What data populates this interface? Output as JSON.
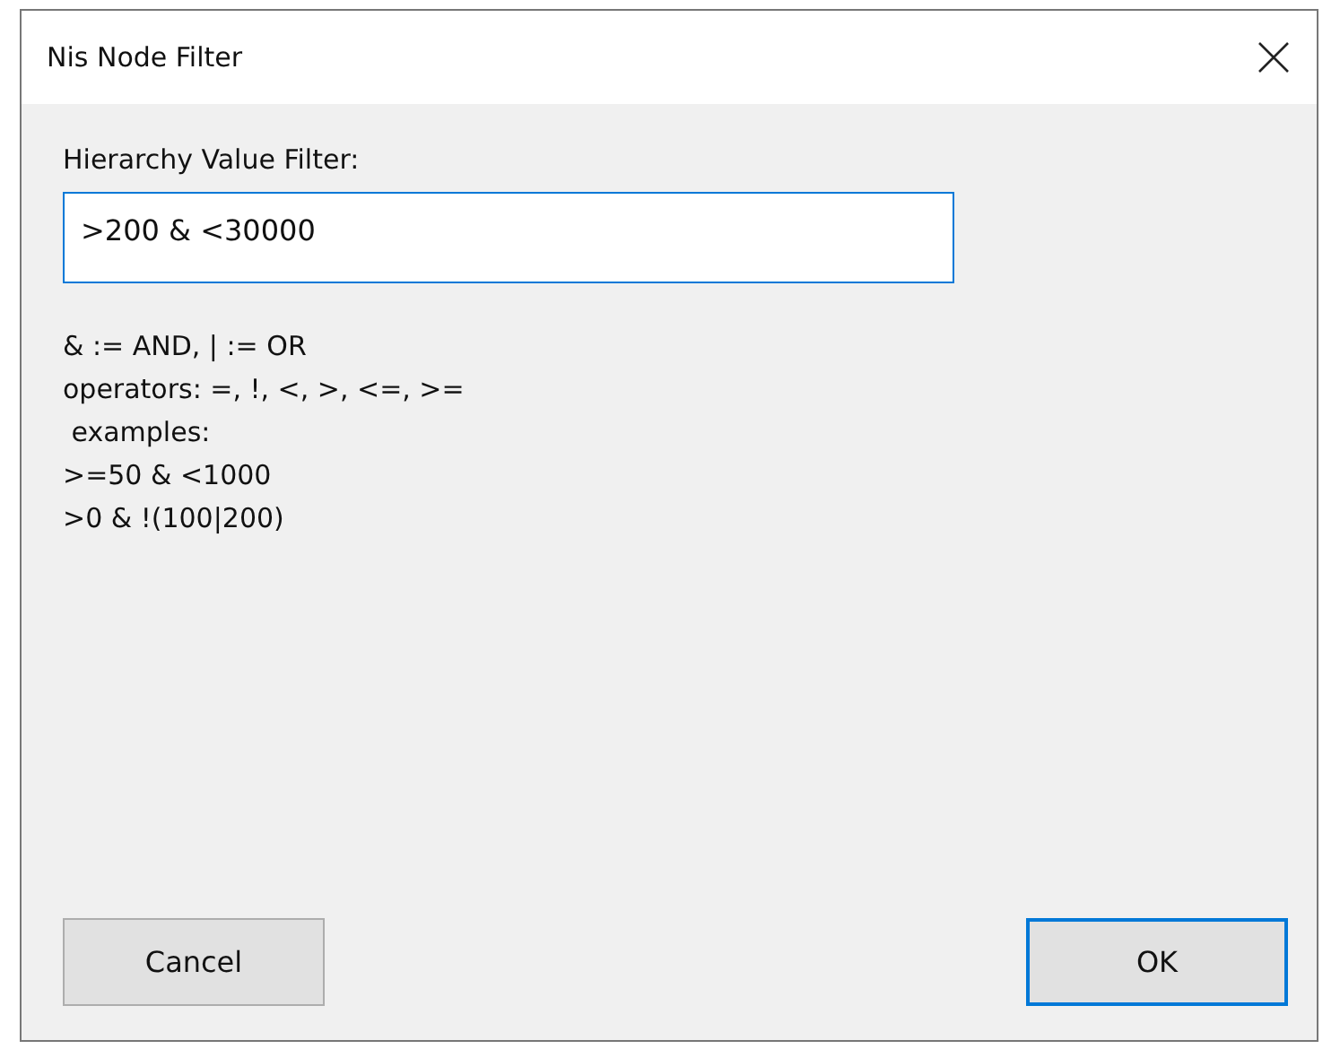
{
  "window": {
    "title": "Nis Node Filter"
  },
  "filter": {
    "label": "Hierarchy Value Filter:",
    "value": ">200 & <30000"
  },
  "help_lines": [
    "& := AND, | := OR",
    "operators: =, !, <, >, <=, >=",
    " examples:",
    ">=50 & <1000",
    ">0 & !(100|200)"
  ],
  "buttons": [
    {
      "label": "Cancel",
      "focused": false
    },
    {
      "label": "OK",
      "focused": true
    }
  ]
}
